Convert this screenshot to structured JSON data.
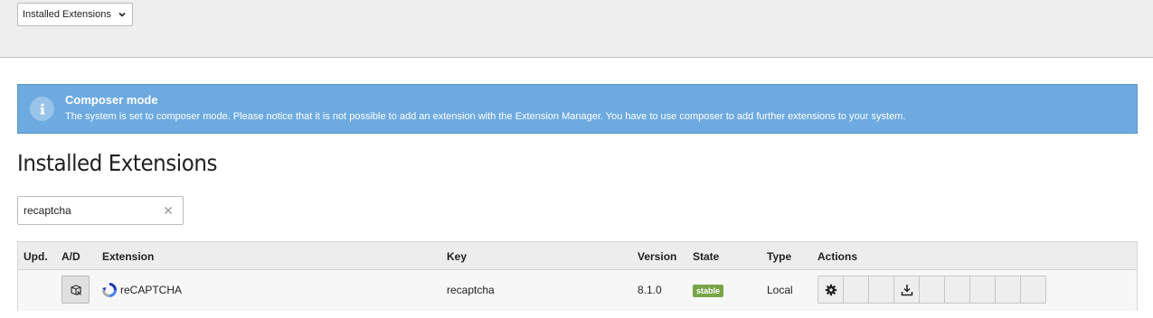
{
  "docheader": {
    "menu_select": {
      "selected": "Installed Extensions"
    }
  },
  "callout": {
    "title": "Composer mode",
    "body": "The system is set to composer mode. Please notice that it is not possible to add an extension with the Extension Manager. You have to use composer to add further extensions to your system.",
    "icon": "info-icon",
    "color": "#6daae0"
  },
  "page": {
    "title": "Installed Extensions"
  },
  "search": {
    "value": "recaptcha",
    "clear_icon": "close-icon"
  },
  "table": {
    "headers": {
      "upd": "Upd.",
      "ad": "A/D",
      "extension": "Extension",
      "key": "Key",
      "version": "Version",
      "state": "State",
      "type": "Type",
      "actions": "Actions"
    },
    "rows": [
      {
        "extension": "reCAPTCHA",
        "key": "recaptcha",
        "version": "8.1.0",
        "state": "stable",
        "type": "Local",
        "ad_icon": "deactivate-icon",
        "extension_icon": "recaptcha-logo-icon",
        "actions": [
          "gear-icon",
          "",
          "",
          "download-icon",
          "",
          "",
          "",
          "",
          ""
        ]
      }
    ],
    "state_color": "#79a548"
  }
}
